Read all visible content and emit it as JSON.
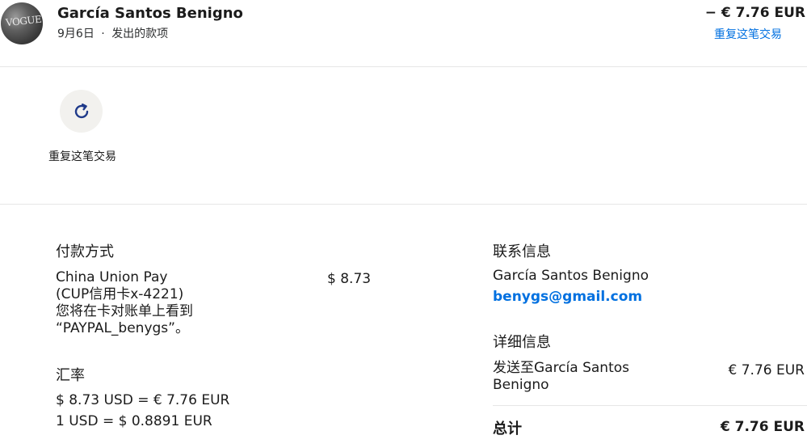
{
  "header": {
    "avatar_text": "VOGUE",
    "name": "García Santos Benigno",
    "date": "9月6日",
    "separator": "·",
    "description": "发出的款项",
    "amount": "− € 7.76 EUR",
    "repeat_link": "重复这笔交易"
  },
  "actions": {
    "repeat_label": "重复这笔交易"
  },
  "payment": {
    "heading": "付款方式",
    "method_text": "China Union Pay\n(CUP信用卡x-4221)\n您将在卡对账单上看到\n“PAYPAL_benygs”。",
    "amount": "$ 8.73"
  },
  "exchange": {
    "heading": "汇率",
    "line1": "$ 8.73 USD = € 7.76 EUR",
    "line2": "1 USD = $ 0.8891 EUR"
  },
  "contact": {
    "heading": "联系信息",
    "name": "García Santos Benigno",
    "email": "benygs@gmail.com"
  },
  "details": {
    "heading": "详细信息",
    "sent_to": "发送至García Santos Benigno",
    "amount": "€ 7.76 EUR",
    "total_label": "总计",
    "total_amount": "€ 7.76 EUR"
  },
  "colors": {
    "link": "#0070e0",
    "icon": "#1f3a8a"
  }
}
